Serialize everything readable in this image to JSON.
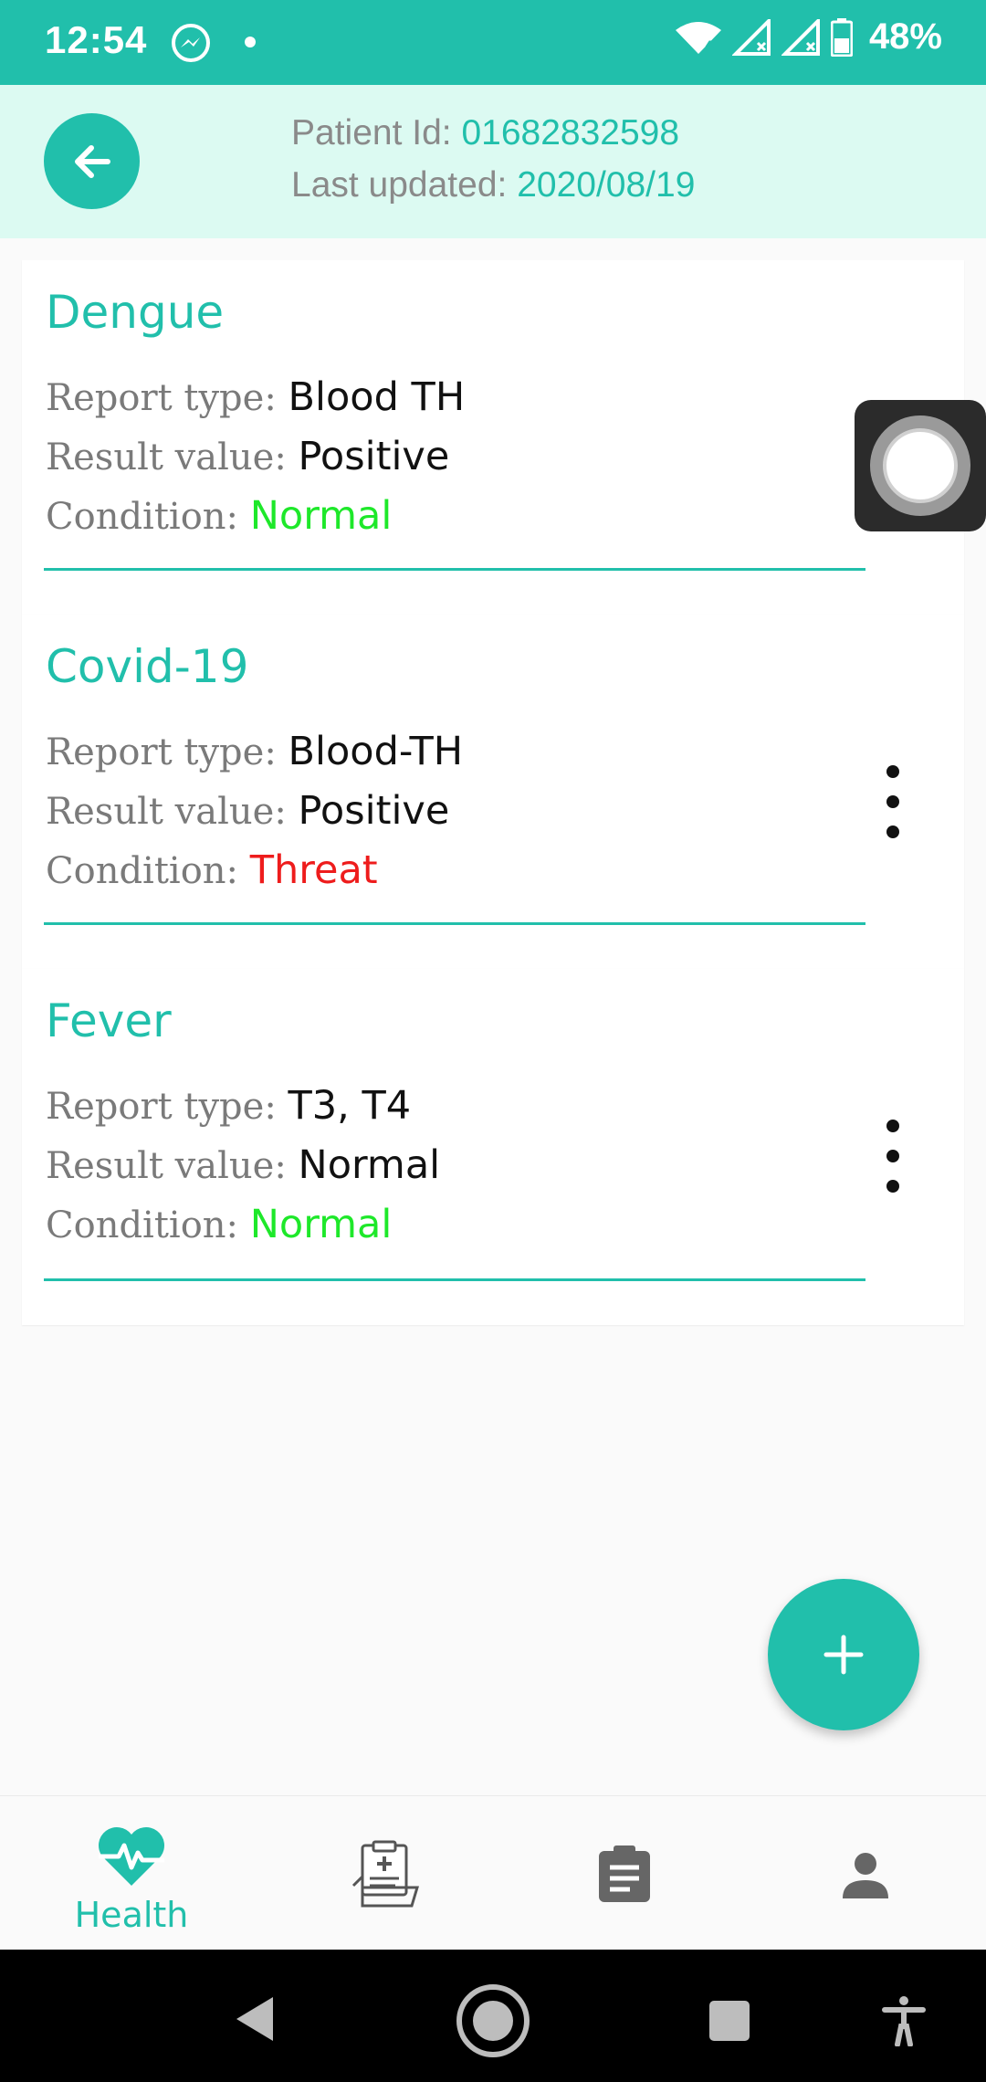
{
  "status_bar": {
    "time": "12:54",
    "battery_percent": "48%",
    "icons": [
      "messenger-icon",
      "notification-dot-icon",
      "wifi-icon",
      "signal-icon",
      "signal-icon",
      "battery-icon"
    ]
  },
  "header": {
    "patient_id_label": "Patient Id: ",
    "patient_id_value": "01682832598",
    "last_updated_label": "Last updated: ",
    "last_updated_value": "2020/08/19"
  },
  "reports": [
    {
      "title": "Dengue",
      "report_type_label": "Report type: ",
      "report_type": "Blood TH",
      "result_value_label": "Result value: ",
      "result_value": "Positive",
      "condition_label": "Condition: ",
      "condition": "Normal"
    },
    {
      "title": "Covid-19",
      "report_type_label": "Report type: ",
      "report_type": "Blood-TH",
      "result_value_label": "Result value: ",
      "result_value": "Positive",
      "condition_label": "Condition: ",
      "condition": "Threat"
    },
    {
      "title": "Fever",
      "report_type_label": "Report type: ",
      "report_type": "T3, T4",
      "result_value_label": "Result value: ",
      "result_value": "Normal",
      "condition_label": "Condition: ",
      "condition": "Normal"
    }
  ],
  "bottom_nav": {
    "items": [
      {
        "label": "Health",
        "icon": "heart-pulse-icon",
        "active": true
      },
      {
        "label": "",
        "icon": "medical-records-icon",
        "active": false
      },
      {
        "label": "",
        "icon": "clipboard-icon",
        "active": false
      },
      {
        "label": "",
        "icon": "person-icon",
        "active": false
      }
    ]
  },
  "colors": {
    "accent": "#21bfab",
    "header_bg": "#dcfaf2",
    "condition_normal": "#1ee82a",
    "condition_threat": "#ee1c1c"
  }
}
